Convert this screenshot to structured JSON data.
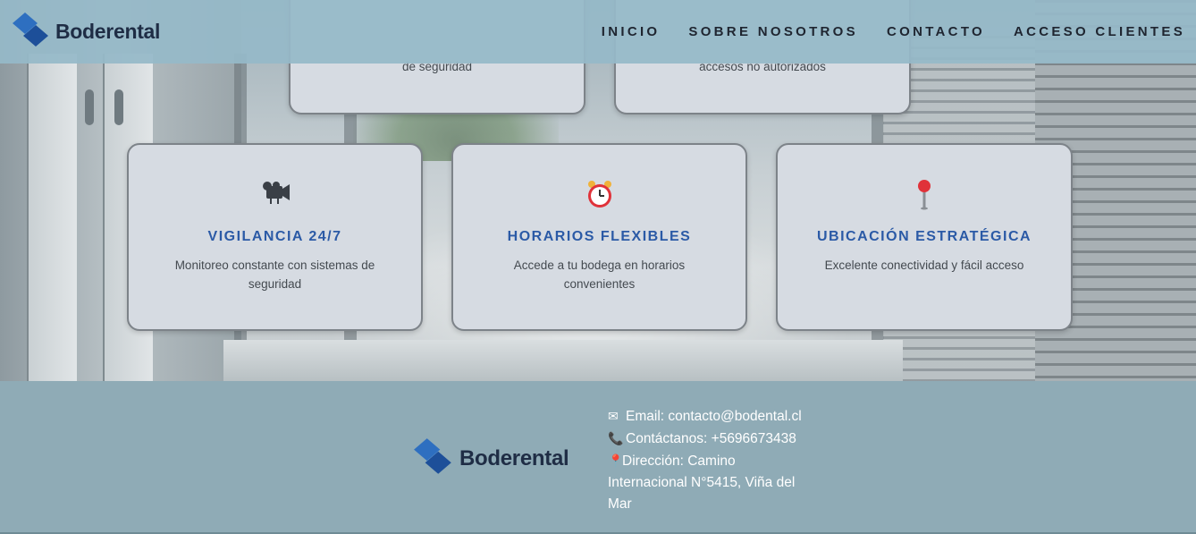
{
  "brand": {
    "name": "Boderental"
  },
  "nav": {
    "items": [
      {
        "label": "INICIO"
      },
      {
        "label": "SOBRE NOSOTROS"
      },
      {
        "label": "CONTACTO"
      },
      {
        "label": "ACCESO CLIENTES"
      }
    ]
  },
  "top_cards": [
    {
      "desc": "de seguridad"
    },
    {
      "desc": "accesos no autorizados"
    }
  ],
  "features": [
    {
      "icon": "video-camera-icon",
      "title": "VIGILANCIA 24/7",
      "desc": "Monitoreo constante con sistemas de seguridad"
    },
    {
      "icon": "alarm-clock-icon",
      "title": "HORARIOS FLEXIBLES",
      "desc": "Accede a tu bodega en horarios convenientes"
    },
    {
      "icon": "map-pin-icon",
      "title": "UBICACIÓN ESTRATÉGICA",
      "desc": "Excelente conectividad y fácil acceso"
    }
  ],
  "footer": {
    "brand_name": "Boderental",
    "email": "Email: contacto@bodental.cl",
    "phone": "Contáctanos: +5696673438",
    "address": "Dirección: Camino Internacional N°5415, Viña del Mar"
  },
  "colors": {
    "header_bg": "#96b9c8",
    "card_bg": "#d6dbe2",
    "title_blue": "#2b5aa6",
    "footer_bg": "#8fabb6",
    "brand_dark": "#1f2d45"
  }
}
